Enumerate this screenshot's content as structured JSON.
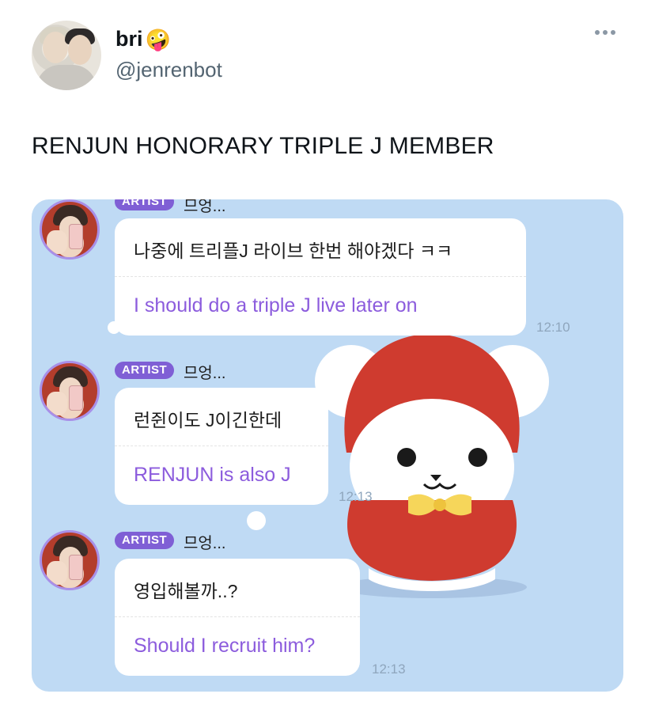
{
  "tweet": {
    "display_name": "bri",
    "handle": "@jenrenbot",
    "text": "RENJUN HONORARY TRIPLE J MEMBER",
    "emoji": "🤪",
    "more_icon": "more-horizontal-icon"
  },
  "chat": {
    "messages": [
      {
        "badge": "ARTIST",
        "sender": "므엉...",
        "korean": "나중에 트리플J 라이브 한번 해야겠다 ㅋㅋ",
        "english": "I should do a triple J live later on",
        "time": "12:10"
      },
      {
        "badge": "ARTIST",
        "sender": "므엉...",
        "korean": "런쥔이도 J이긴한데",
        "english": "RENJUN is also J",
        "time": "12:13"
      },
      {
        "badge": "ARTIST",
        "sender": "므엉...",
        "korean": "영입해볼까..?",
        "english": "Should I recruit him?",
        "time": "12:13"
      }
    ]
  },
  "colors": {
    "chat_background": "#bfdaf4",
    "badge": "#7f5fd5",
    "translation_text": "#8c5cdd",
    "handle": "#536471"
  }
}
